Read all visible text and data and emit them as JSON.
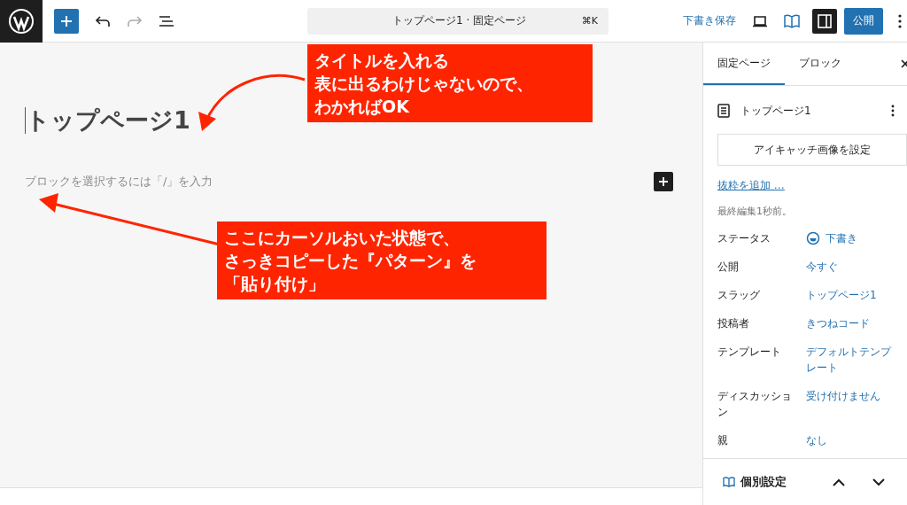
{
  "toolbar": {
    "document_title": "トップページ1 · 固定ページ",
    "shortcut": "⌘K",
    "save_draft": "下書き保存",
    "publish": "公開"
  },
  "editor": {
    "title": "トップページ1",
    "placeholder": "ブロックを選択するには「/」を入力"
  },
  "annotations": [
    {
      "lines": [
        "タイトルを入れる",
        "表に出るわけじゃないので、",
        "わかればOK"
      ]
    },
    {
      "lines": [
        "ここにカーソルおいた状態で、",
        "さっきコピーした『パターン』を",
        "「貼り付け」"
      ]
    }
  ],
  "sidebar": {
    "tabs": [
      {
        "label": "固定ページ",
        "selected": true
      },
      {
        "label": "ブロック",
        "selected": false
      }
    ],
    "page_title": "トップページ1",
    "featured_image_button": "アイキャッチ画像を設定",
    "excerpt_link": "抜粋を追加 …",
    "last_edited": "最終編集1秒前。",
    "fields": [
      {
        "kind": "status",
        "label": "ステータス",
        "value": "下書き"
      },
      {
        "kind": "link",
        "label": "公開",
        "value": "今すぐ"
      },
      {
        "kind": "link",
        "label": "スラッグ",
        "value": "トップページ1"
      },
      {
        "kind": "link",
        "label": "投稿者",
        "value": "きつねコード"
      },
      {
        "kind": "link",
        "label": "テンプレート",
        "value": "デフォルトテンプレート"
      },
      {
        "kind": "link",
        "label": "ディスカッション",
        "value": "受け付けません"
      },
      {
        "kind": "link",
        "label": "親",
        "value": "なし"
      }
    ],
    "panel": {
      "title": "個別設定"
    }
  }
}
